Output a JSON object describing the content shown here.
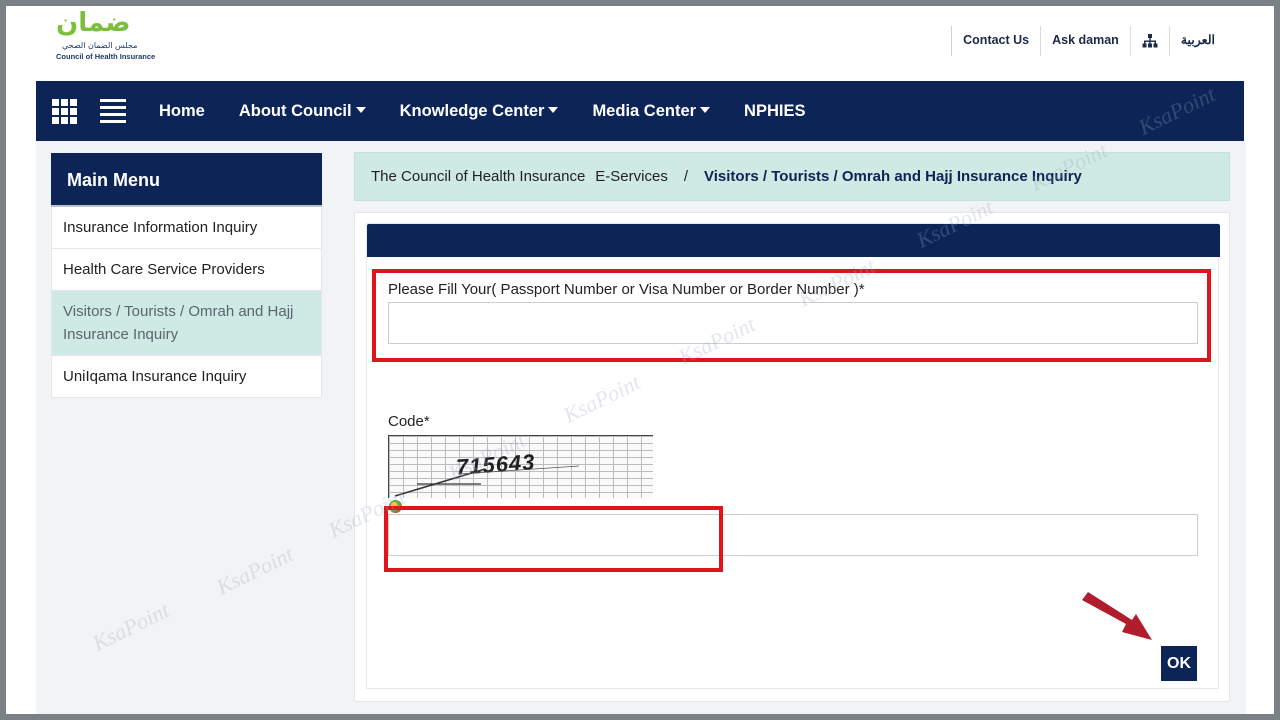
{
  "header": {
    "logo_ar_main": "ضمان",
    "logo_ar_sub": "مجلس الضمان الصحي",
    "logo_en": "Council of Health Insurance",
    "links": [
      "Contact Us",
      "Ask daman",
      "العربية"
    ]
  },
  "nav": {
    "items": [
      {
        "label": "Home",
        "dropdown": false
      },
      {
        "label": "About Council",
        "dropdown": true
      },
      {
        "label": "Knowledge Center",
        "dropdown": true
      },
      {
        "label": "Media Center",
        "dropdown": true
      },
      {
        "label": "NPHIES",
        "dropdown": false
      }
    ]
  },
  "sidebar": {
    "title": "Main Menu",
    "items": [
      {
        "label": "Insurance Information Inquiry"
      },
      {
        "label": "Health Care Service Providers"
      },
      {
        "label": "Visitors / Tourists / Omrah and Hajj Insurance Inquiry",
        "active": true
      },
      {
        "label": "UniIqama Insurance Inquiry"
      }
    ]
  },
  "breadcrumb": {
    "home": "The Council of Health Insurance",
    "section": "E-Services",
    "separator": "/",
    "current": "Visitors / Tourists / Omrah and Hajj Insurance Inquiry"
  },
  "form": {
    "passport_label": "Please Fill Your( Passport Number or Visa Number or Border Number )*",
    "passport_value": "",
    "code_label": "Code*",
    "captcha_text": "715643",
    "code_value": "",
    "ok_label": "OK"
  },
  "watermark": "KsaPoint",
  "colors": {
    "navy": "#0c2556",
    "mint": "#cfe9e4",
    "highlight_red": "#e1141b",
    "arrow": "#b01e2e"
  }
}
